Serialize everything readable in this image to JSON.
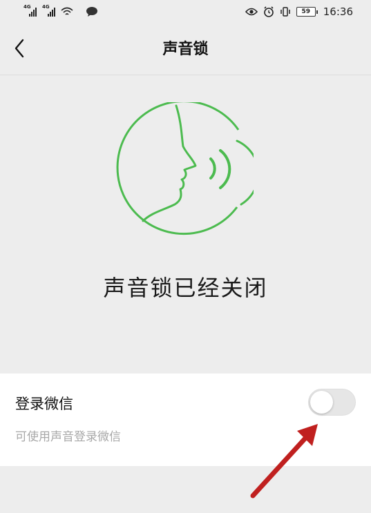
{
  "status_bar": {
    "network_tag_1": "4G",
    "network_tag_2": "4G",
    "battery_level": "59",
    "time": "16:36"
  },
  "nav": {
    "title": "声音锁",
    "back_icon": "chevron-left-icon"
  },
  "voice_lock": {
    "illustration_icon": "voice-face-icon",
    "status_message": "声音锁已经关闭",
    "accent_color": "#4cbb4f"
  },
  "settings": {
    "login_wechat": {
      "title": "登录微信",
      "description": "可使用声音登录微信",
      "enabled": false
    }
  },
  "annotation": {
    "arrow_color": "#c0201f"
  }
}
